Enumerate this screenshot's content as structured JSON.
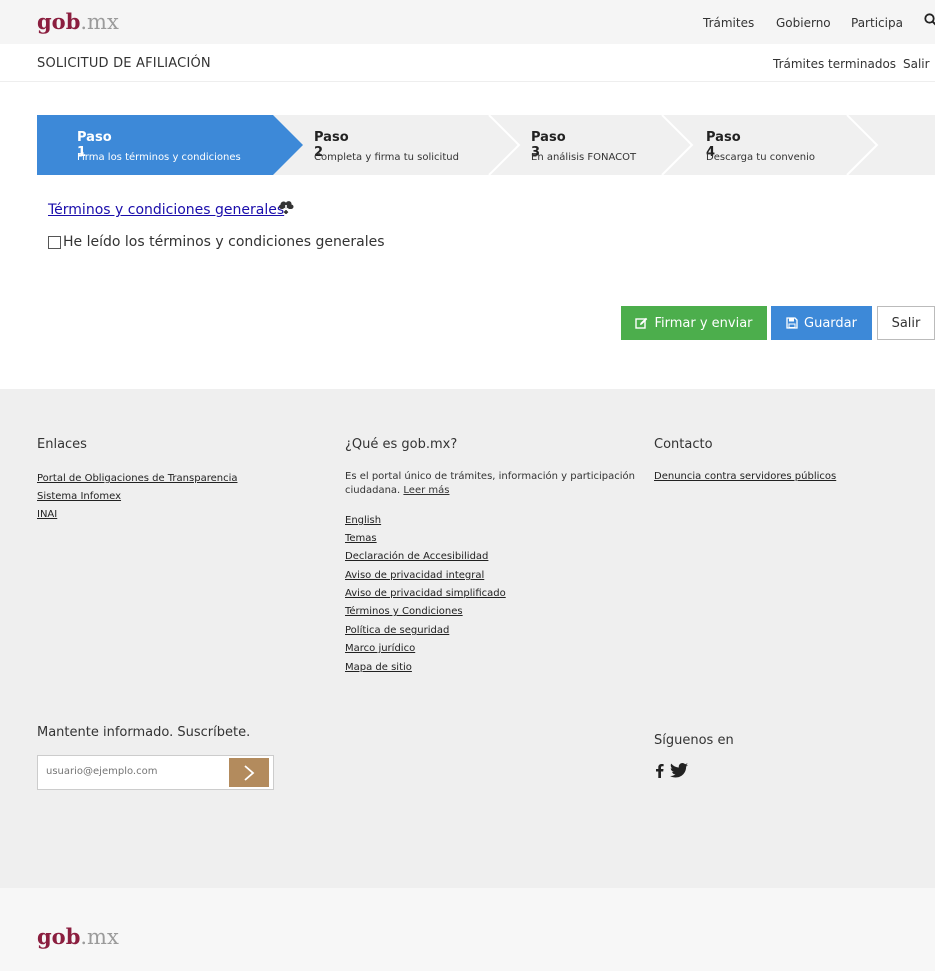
{
  "header": {
    "brand_main": "gob",
    "brand_suffix": ".mx",
    "nav": [
      "Trámites",
      "Gobierno",
      "Participa"
    ]
  },
  "subheader": {
    "title": "SOLICITUD DE AFILIACIÓN",
    "nav": [
      "Trámites terminados",
      "Salir"
    ]
  },
  "steps": [
    {
      "title": "Paso 1",
      "subtitle": "Firma los términos y condiciones",
      "active": true
    },
    {
      "title": "Paso 2",
      "subtitle": "Completa y firma tu solicitud",
      "active": false
    },
    {
      "title": "Paso 3",
      "subtitle": "En análisis FONACOT",
      "active": false
    },
    {
      "title": "Paso 4",
      "subtitle": "Descarga tu convenio",
      "active": false
    }
  ],
  "terms": {
    "link_label": "Términos y condiciones generales",
    "checkbox_label": "He leído los términos y condiciones generales",
    "checked": false
  },
  "actions": {
    "sign_label": "Firmar y enviar",
    "save_label": "Guardar",
    "exit_label": "Salir"
  },
  "footer": {
    "links_title": "Enlaces",
    "links": [
      "Portal de Obligaciones de Transparencia",
      "Sistema Infomex",
      "INAI"
    ],
    "about_title": "¿Qué es gob.mx?",
    "about_text": "Es el portal único de trámites, información y participación ciudadana.",
    "about_more": "Leer más",
    "about_links": [
      "English",
      "Temas",
      "Declaración de Accesibilidad",
      "Aviso de privacidad integral",
      "Aviso de privacidad simplificado",
      "Términos y Condiciones",
      "Política de seguridad",
      "Marco jurídico",
      "Mapa de sitio"
    ],
    "contact_title": "Contacto",
    "contact_link": "Denuncia contra servidores públicos",
    "subscribe_title": "Mantente informado. Suscríbete.",
    "subscribe_placeholder": "usuario@ejemplo.com",
    "social_title": "Síguenos en",
    "brand_main": "gob",
    "brand_suffix": ".mx"
  },
  "colors": {
    "brand": "#8b1e3f",
    "step_active": "#3d89d8",
    "sign_button": "#4cae4c",
    "save_button": "#3d89d8",
    "subscribe_button": "#b38b5d",
    "footer_bg": "#efefef"
  },
  "icons": {
    "search": "search-icon",
    "cloud_download": "cloud-download-icon",
    "edit": "edit-icon",
    "save": "floppy-disk-icon",
    "arrow": "chevron-right-icon",
    "facebook": "facebook-icon",
    "twitter": "twitter-icon"
  }
}
